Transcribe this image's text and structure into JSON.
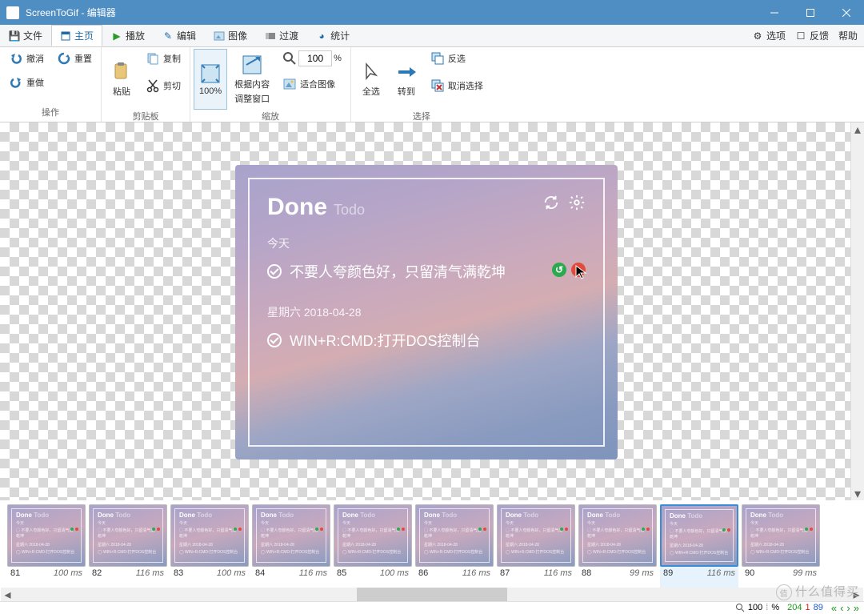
{
  "window": {
    "title": "ScreenToGif - 编辑器"
  },
  "tabs": {
    "file": "文件",
    "home": "主页",
    "play": "播放",
    "edit": "编辑",
    "image": "图像",
    "transition": "过渡",
    "stats": "统计"
  },
  "rightmenu": {
    "options": "选项",
    "feedback": "反馈",
    "help": "帮助"
  },
  "ribbon": {
    "undo": "撤消",
    "redo": "重做",
    "reset": "重置",
    "actions": "操作",
    "paste": "粘贴",
    "copy": "复制",
    "cut": "剪切",
    "clipboard": "剪贴板",
    "zoom100": "100%",
    "fitcontent_l1": "根据内容",
    "fitcontent_l2": "调整窗口",
    "fitimage": "适合图像",
    "zoom_value": "100",
    "pct": "%",
    "zoom_group": "缩放",
    "selectall": "全选",
    "goto": "转到",
    "invert": "反选",
    "deselect": "取消选择",
    "selection": "选择"
  },
  "preview": {
    "title": "Done",
    "subtitle": "Todo",
    "section1": "今天",
    "item1": "不要人夸颜色好，只留清气满乾坤",
    "section2": "星期六 2018-04-28",
    "item2": "WIN+R:CMD:打开DOS控制台"
  },
  "thumbs": [
    {
      "idx": "81",
      "dur": "100 ms"
    },
    {
      "idx": "82",
      "dur": "116 ms"
    },
    {
      "idx": "83",
      "dur": "100 ms"
    },
    {
      "idx": "84",
      "dur": "116 ms"
    },
    {
      "idx": "85",
      "dur": "100 ms"
    },
    {
      "idx": "86",
      "dur": "116 ms"
    },
    {
      "idx": "87",
      "dur": "116 ms"
    },
    {
      "idx": "88",
      "dur": "99 ms"
    },
    {
      "idx": "89",
      "dur": "116 ms"
    },
    {
      "idx": "90",
      "dur": "99 ms"
    }
  ],
  "timeline": {
    "selected_index": 8
  },
  "status": {
    "zoom": "100",
    "pct": "%",
    "v1": "204",
    "v2": "1",
    "v3": "89"
  },
  "watermark": "什么值得买"
}
